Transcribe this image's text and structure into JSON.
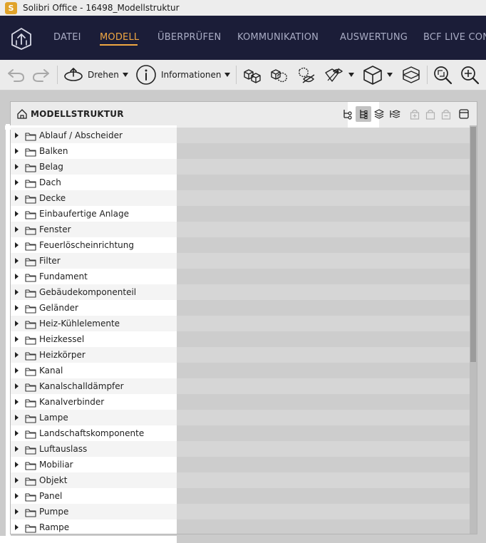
{
  "window": {
    "app_icon_letter": "S",
    "title": "Solibri Office - 16498_Modellstruktur"
  },
  "menu": {
    "items": [
      "DATEI",
      "MODELL",
      "ÜBERPRÜFEN",
      "KOMMUNIKATION",
      "AUSWERTUNG",
      "BCF LIVE CONN"
    ],
    "active": "MODELL"
  },
  "toolbar": {
    "rotate_label": "Drehen",
    "info_label": "Informationen"
  },
  "panel": {
    "title": "MODELLSTRUKTUR",
    "items": [
      "Ablauf / Abscheider",
      "Balken",
      "Belag",
      "Dach",
      "Decke",
      "Einbaufertige Anlage",
      "Fenster",
      "Feuerlöscheinrichtung",
      "Filter",
      "Fundament",
      "Gebäudekomponenteil",
      "Geländer",
      "Heiz-Kühlelemente",
      "Heizkessel",
      "Heizkörper",
      "Kanal",
      "Kanalschalldämpfer",
      "Kanalverbinder",
      "Lampe",
      "Landschaftskomponente",
      "Luftauslass",
      "Mobiliar",
      "Objekt",
      "Panel",
      "Pumpe",
      "Rampe"
    ]
  },
  "colors": {
    "menubar_bg": "#1b1d38",
    "menu_active": "#f0a742",
    "menu_text": "#a9acc4"
  }
}
